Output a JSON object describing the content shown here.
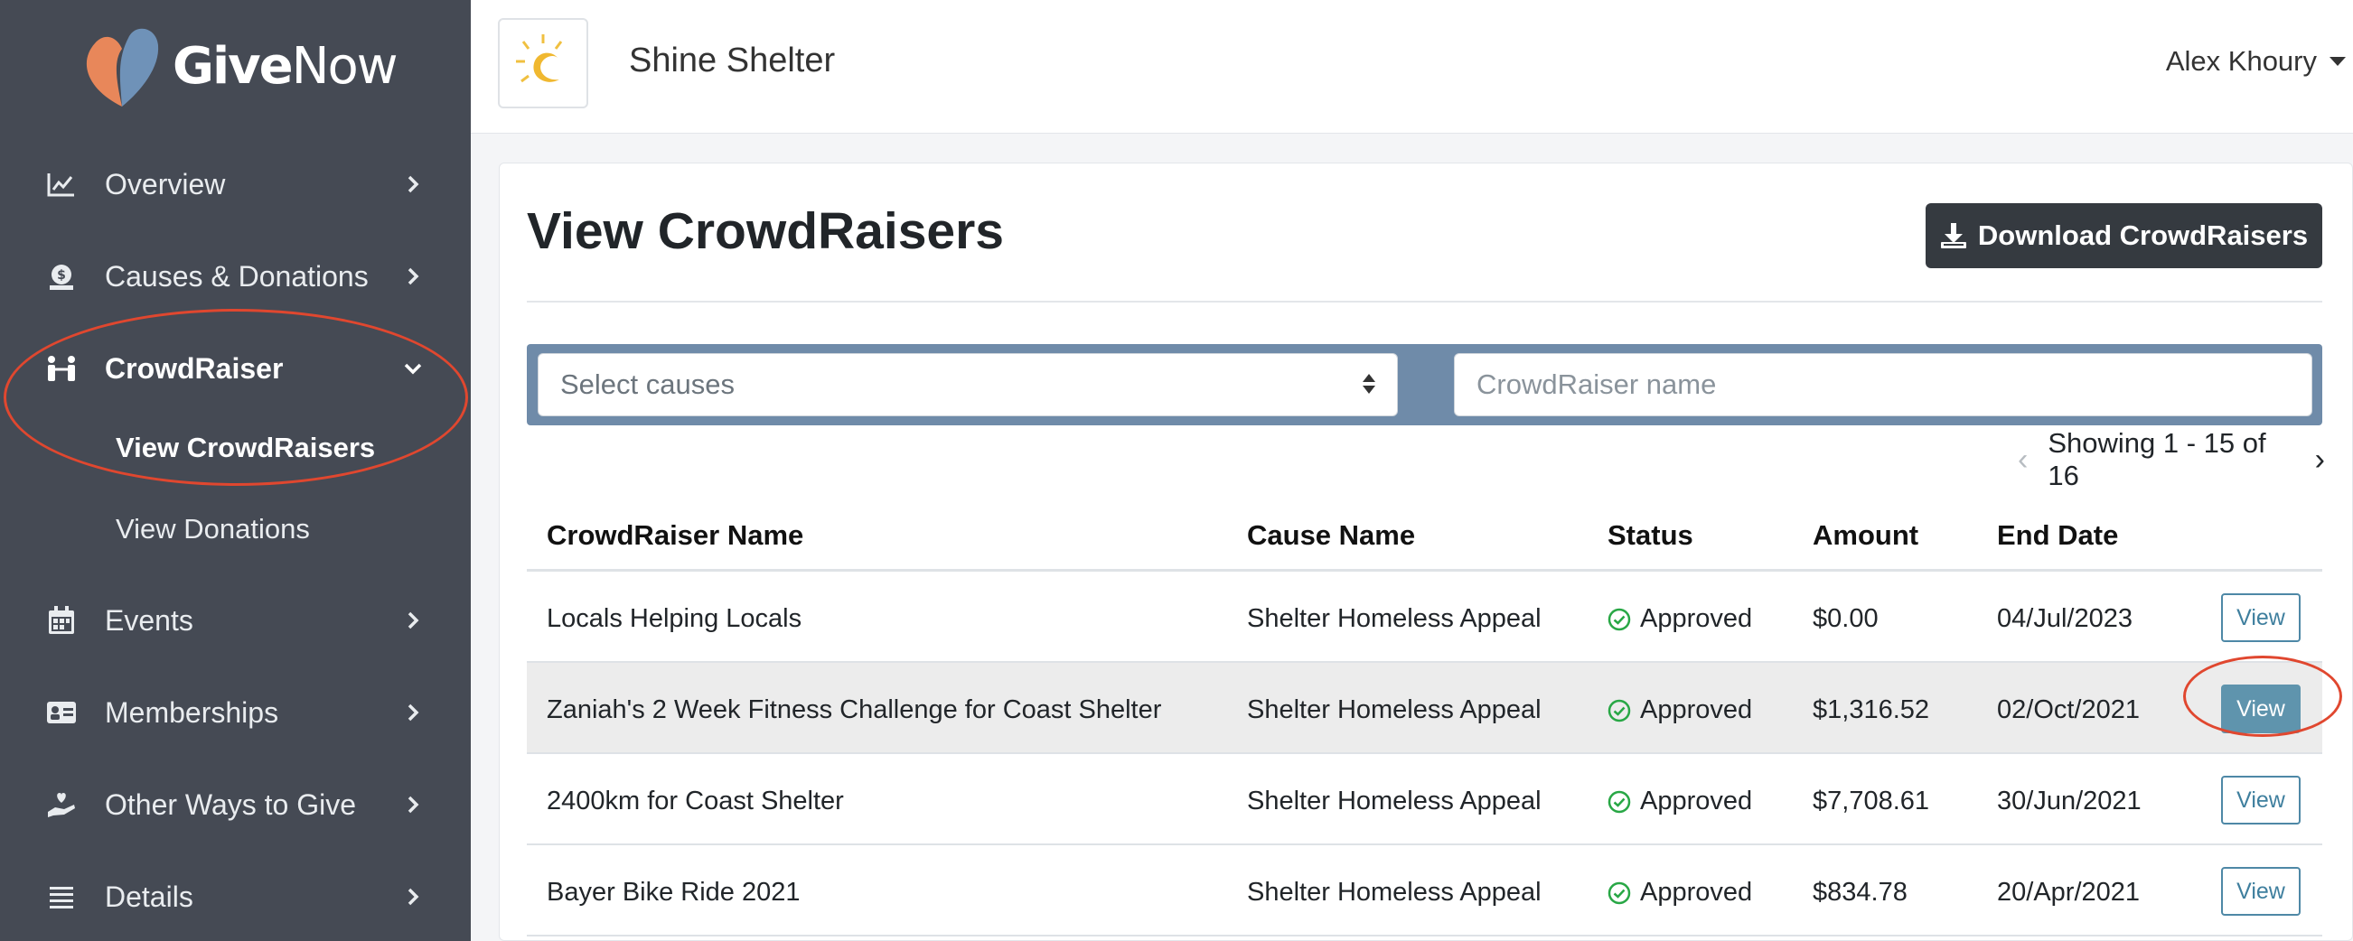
{
  "brand": {
    "name_bold": "Give",
    "name_light": "Now"
  },
  "sidebar": {
    "items": [
      {
        "label": "Overview",
        "icon": "line-chart-icon"
      },
      {
        "label": "Causes & Donations",
        "icon": "money-bag-icon"
      },
      {
        "label": "CrowdRaiser",
        "icon": "people-icon",
        "expanded": true
      },
      {
        "label": "Events",
        "icon": "calendar-icon"
      },
      {
        "label": "Memberships",
        "icon": "id-card-icon"
      },
      {
        "label": "Other Ways to Give",
        "icon": "hand-heart-icon"
      },
      {
        "label": "Details",
        "icon": "list-icon"
      }
    ],
    "subitems": [
      {
        "label": "View CrowdRaisers",
        "active": true
      },
      {
        "label": "View Donations",
        "active": false
      }
    ]
  },
  "header": {
    "org_name": "Shine Shelter",
    "user_name": "Alex Khoury"
  },
  "main": {
    "title": "View CrowdRaisers",
    "download_label": "Download CrowdRaisers",
    "filters": {
      "select_placeholder": "Select causes",
      "name_placeholder": "CrowdRaiser name"
    },
    "pagination": {
      "text": "Showing 1 - 15 of 16",
      "prev": "‹",
      "next": "›"
    },
    "table": {
      "columns": [
        "CrowdRaiser Name",
        "Cause Name",
        "Status",
        "Amount",
        "End Date"
      ],
      "rows": [
        {
          "name": "Locals Helping Locals",
          "cause": "Shelter Homeless Appeal",
          "status": "Approved",
          "amount": "$0.00",
          "end_date": "04/Jul/2023",
          "action": "View"
        },
        {
          "name": "Zaniah's 2 Week Fitness Challenge for Coast Shelter",
          "cause": "Shelter Homeless Appeal",
          "status": "Approved",
          "amount": "$1,316.52",
          "end_date": "02/Oct/2021",
          "action": "View"
        },
        {
          "name": "2400km for Coast Shelter",
          "cause": "Shelter Homeless Appeal",
          "status": "Approved",
          "amount": "$7,708.61",
          "end_date": "30/Jun/2021",
          "action": "View"
        },
        {
          "name": "Bayer Bike Ride 2021",
          "cause": "Shelter Homeless Appeal",
          "status": "Approved",
          "amount": "$834.78",
          "end_date": "20/Apr/2021",
          "action": "View"
        }
      ]
    }
  },
  "colors": {
    "sidebar_bg": "#454a54",
    "filter_bg": "#6f8ba9",
    "button_dark": "#353a40",
    "view_accent": "#4e88a6",
    "annotation": "#e0472f",
    "approved": "#28a745"
  }
}
